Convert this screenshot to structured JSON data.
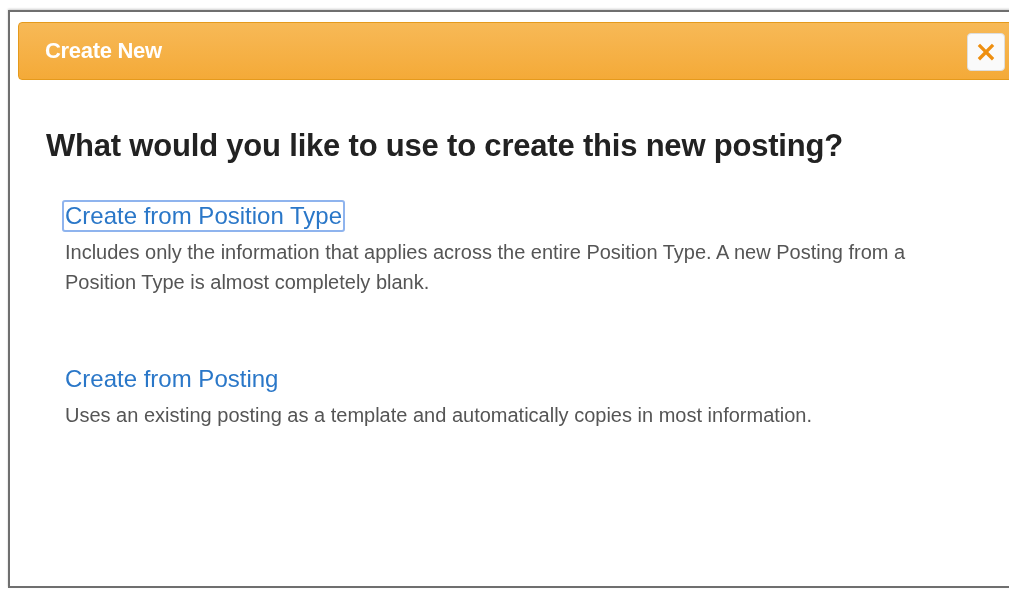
{
  "dialog": {
    "title": "Create New",
    "close_label": "×"
  },
  "heading": "What would you like to use to create this new posting?",
  "options": [
    {
      "label": "Create from Position Type",
      "focused": true,
      "description": "Includes only the information that applies across the entire Position Type. A new Posting from a Position Type is almost completely blank."
    },
    {
      "label": "Create from Posting",
      "focused": false,
      "description": "Uses an existing posting as a template and automatically copies in most information."
    }
  ]
}
